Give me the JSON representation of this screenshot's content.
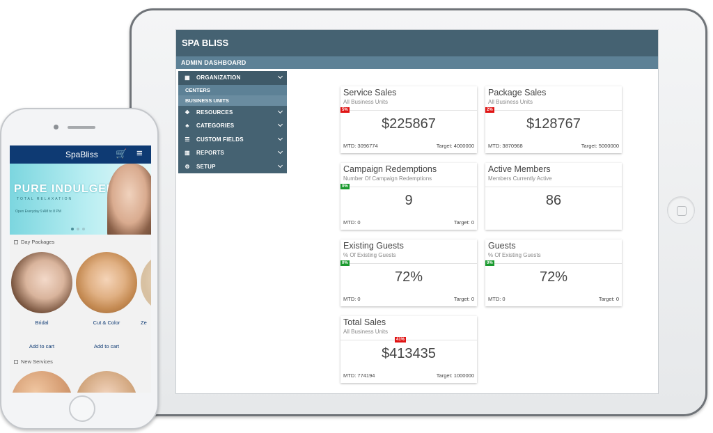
{
  "tablet": {
    "app_title": "SPA BLISS",
    "page_title": "ADMIN DASHBOARD",
    "menu": [
      {
        "label": "ORGANIZATION",
        "icon": "building-icon"
      },
      {
        "label": "RESOURCES",
        "icon": "cubes-icon"
      },
      {
        "label": "CATEGORIES",
        "icon": "sitemap-icon"
      },
      {
        "label": "CUSTOM FIELDS",
        "icon": "sliders-icon"
      },
      {
        "label": "REPORTS",
        "icon": "bar-chart-icon"
      },
      {
        "label": "SETUP",
        "icon": "gear-icon"
      }
    ],
    "submenu": [
      "CENTERS",
      "BUSINESS UNITS"
    ],
    "cards": [
      {
        "title": "Service Sales",
        "sub": "All Business Units",
        "badge": "5%",
        "badge_color": "#e01414",
        "value": "$225867",
        "mtd": "MTD: 3096774",
        "target": "Target: 4000000"
      },
      {
        "title": "Package Sales",
        "sub": "All Business Units",
        "badge": "2%",
        "badge_color": "#e01414",
        "value": "$128767",
        "mtd": "MTD: 3870968",
        "target": "Target: 5000000"
      },
      {
        "title": "Campaign Redemptions",
        "sub": "Number Of Campaign Redemptions",
        "badge": "0%",
        "badge_color": "#1a9a2e",
        "value": "9",
        "mtd": "MTD: 0",
        "target": "Target: 0"
      },
      {
        "title": "Active Members",
        "sub": "Members Currently Active",
        "badge": "",
        "value": "86",
        "mtd": "",
        "target": ""
      },
      {
        "title": "Existing Guests",
        "sub": "% Of Existing Guests",
        "badge": "0%",
        "badge_color": "#1a9a2e",
        "value": "72%",
        "mtd": "MTD: 0",
        "target": "Target: 0"
      },
      {
        "title": "Guests",
        "sub": "% Of Existing Guests",
        "badge": "0%",
        "badge_color": "#1a9a2e",
        "value": "72%",
        "mtd": "MTD: 0",
        "target": "Target: 0"
      },
      {
        "title": "Total Sales",
        "sub": "All Business Units",
        "badge": "41%",
        "badge_color": "#e01414",
        "value": "$413435",
        "mtd": "MTD: 774194",
        "target": "Target: 1000000"
      }
    ]
  },
  "phone": {
    "app_title": "SpaBliss",
    "hero_title": "PURE INDULGENCE",
    "hero_sub": "TOTAL RELAXATION",
    "hero_hours": "Open Everyday 9 AM to 8 PM",
    "section1": "Day Packages",
    "items": [
      "Bridal",
      "Cut & Color",
      "Ze"
    ],
    "add_to_cart": "Add to cart",
    "section2": "New Services",
    "accent": "#0e3a73"
  }
}
